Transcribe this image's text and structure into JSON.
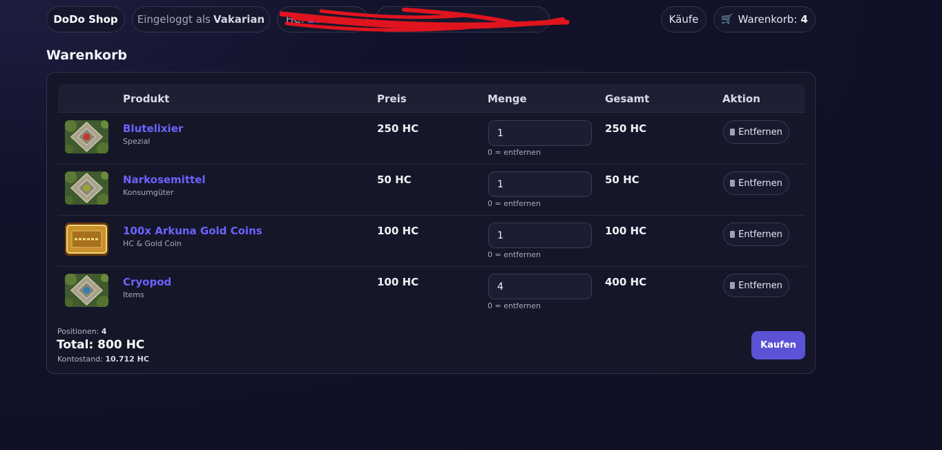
{
  "header": {
    "brand": "DoDo Shop",
    "login_prefix": "Eingeloggt als",
    "username": "Vakarian",
    "hc_label": "HC:",
    "hc_value": "10",
    "purchases_label": "Käufe",
    "cart_label": "Warenkorb:",
    "cart_count": "4"
  },
  "page": {
    "title": "Warenkorb"
  },
  "table": {
    "headers": {
      "product": "Produkt",
      "price": "Preis",
      "quantity": "Menge",
      "total": "Gesamt",
      "action": "Aktion"
    },
    "rows": [
      {
        "name": "Blutelixier",
        "category": "Spezial",
        "price": "250 HC",
        "quantity": "1",
        "hint": "0 = entfernen",
        "total": "250 HC",
        "remove": "Entfernen",
        "gem": "#c0392b",
        "icon": "red-gem-icon"
      },
      {
        "name": "Narkosemittel",
        "category": "Konsumgüter",
        "price": "50 HC",
        "quantity": "1",
        "hint": "0 = entfernen",
        "total": "50 HC",
        "remove": "Entfernen",
        "gem": "#9aa43a",
        "icon": "green-gem-icon"
      },
      {
        "name": "100x Arkuna Gold Coins",
        "category": "HC & Gold Coin",
        "price": "100 HC",
        "quantity": "1",
        "hint": "0 = entfernen",
        "total": "100 HC",
        "remove": "Entfernen",
        "gem": "#d9a43a",
        "icon": "gold-plaque-icon"
      },
      {
        "name": "Cryopod",
        "category": "Items",
        "price": "100 HC",
        "quantity": "4",
        "hint": "0 = entfernen",
        "total": "400 HC",
        "remove": "Entfernen",
        "gem": "#2e7fb8",
        "icon": "blue-gem-icon"
      }
    ]
  },
  "footer": {
    "positions_label": "Positionen:",
    "positions_value": "4",
    "total_text": "Total: 800 HC",
    "balance_label": "Kontostand:",
    "balance_value": "10.712 HC",
    "buy_label": "Kaufen"
  },
  "colors": {
    "accent": "#6c63ff",
    "buy_button": "#5b52d6",
    "redaction": "#e0141e"
  }
}
